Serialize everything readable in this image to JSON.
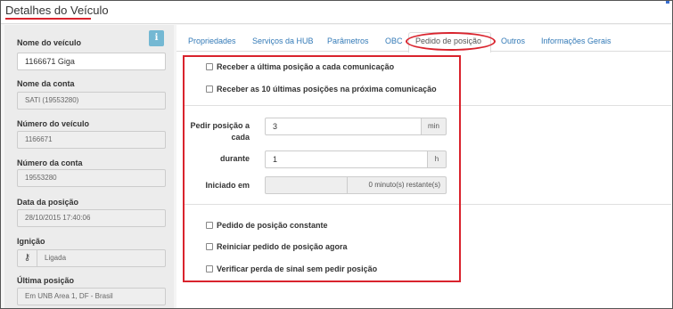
{
  "header": {
    "title": "Detalhes do Veículo"
  },
  "info_icon": "info-icon",
  "vehicle": {
    "name_label": "Nome do veículo",
    "name_value": "1166671 Giga",
    "account_name_label": "Nome da conta",
    "account_name_value": "SATI (19553280)",
    "vehicle_number_label": "Número do veículo",
    "vehicle_number_value": "1166671",
    "account_number_label": "Número da conta",
    "account_number_value": "19553280",
    "position_date_label": "Data da posição",
    "position_date_value": "28/10/2015 17:40:06",
    "ignition_label": "Ignição",
    "ignition_icon": "key-icon",
    "ignition_value": "Ligada",
    "last_position_label": "Última posição",
    "last_position_value": "Em  UNB Area 1, DF - Brasil"
  },
  "tabs": [
    {
      "label": "Propriedades"
    },
    {
      "label": "Serviços da HUB"
    },
    {
      "label": "Parâmetros"
    },
    {
      "label": "OBC"
    },
    {
      "label": "Pedido de posição"
    },
    {
      "label": "Outros"
    },
    {
      "label": "Informações Gerais"
    }
  ],
  "active_tab": "Pedido de posição",
  "position_request": {
    "option_last_position": "Receber a última posição a cada comunicação",
    "option_last_10": "Receber as 10 últimas posições na próxima comunicação",
    "request_every_label_1": "Pedir posição a",
    "request_every_label_2": "cada",
    "request_every_value": "3",
    "request_every_unit": "min",
    "during_label": "durante",
    "during_value": "1",
    "during_unit": "h",
    "started_label": "Iniciado em",
    "started_value": "",
    "remaining_text": "0 minuto(s) restante(s)",
    "option_constant": "Pedido de posição constante",
    "option_restart": "Reiniciar pedido de posição agora",
    "option_signal_loss": "Verificar perda de sinal sem pedir posição"
  },
  "colors": {
    "highlight_red": "#d9232d",
    "link_blue": "#337ab7",
    "info_button": "#74b8d3"
  }
}
